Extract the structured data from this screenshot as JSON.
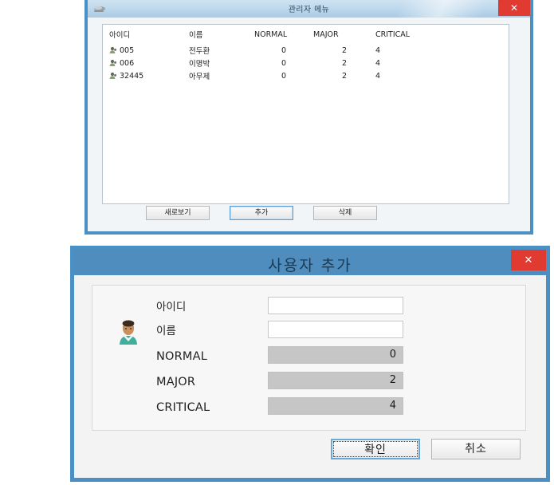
{
  "admin_window": {
    "title": "관리자 메뉴",
    "titlebar_icon": "window-app-icon",
    "close_label": "✕",
    "table": {
      "columns": [
        "아이디",
        "이름",
        "NORMAL",
        "MAJOR",
        "CRITICAL"
      ],
      "rows": [
        {
          "id": "005",
          "name": "전두환",
          "normal": "0",
          "major": "2",
          "critical": "4"
        },
        {
          "id": "006",
          "name": "이명박",
          "normal": "0",
          "major": "2",
          "critical": "4"
        },
        {
          "id": "32445",
          "name": "아무제",
          "normal": "0",
          "major": "2",
          "critical": "4"
        }
      ]
    },
    "buttons": {
      "refresh": "새로보기",
      "add": "추가",
      "delete": "삭제"
    },
    "focused_button": "추가"
  },
  "adduser_window": {
    "title": "사용자 추가",
    "close_label": "✕",
    "avatar_icon": "user-avatar-icon",
    "fields": {
      "id": {
        "label": "아이디",
        "value": "",
        "placeholder": ""
      },
      "name": {
        "label": "이름",
        "value": "",
        "placeholder": ""
      },
      "normal": {
        "label": "NORMAL",
        "value": "0"
      },
      "major": {
        "label": "MAJOR",
        "value": "2"
      },
      "critical": {
        "label": "CRITICAL",
        "value": "4"
      }
    },
    "buttons": {
      "ok": "확인",
      "cancel": "취소"
    },
    "focused_button": "확인"
  },
  "colors": {
    "window_border_blue": "#4b90c4",
    "adduser_titlebar_blue": "#4e8dbd",
    "close_red": "#e03a31",
    "readonly_gray": "#c6c6c6",
    "focus_blue": "#6aa8d8"
  }
}
